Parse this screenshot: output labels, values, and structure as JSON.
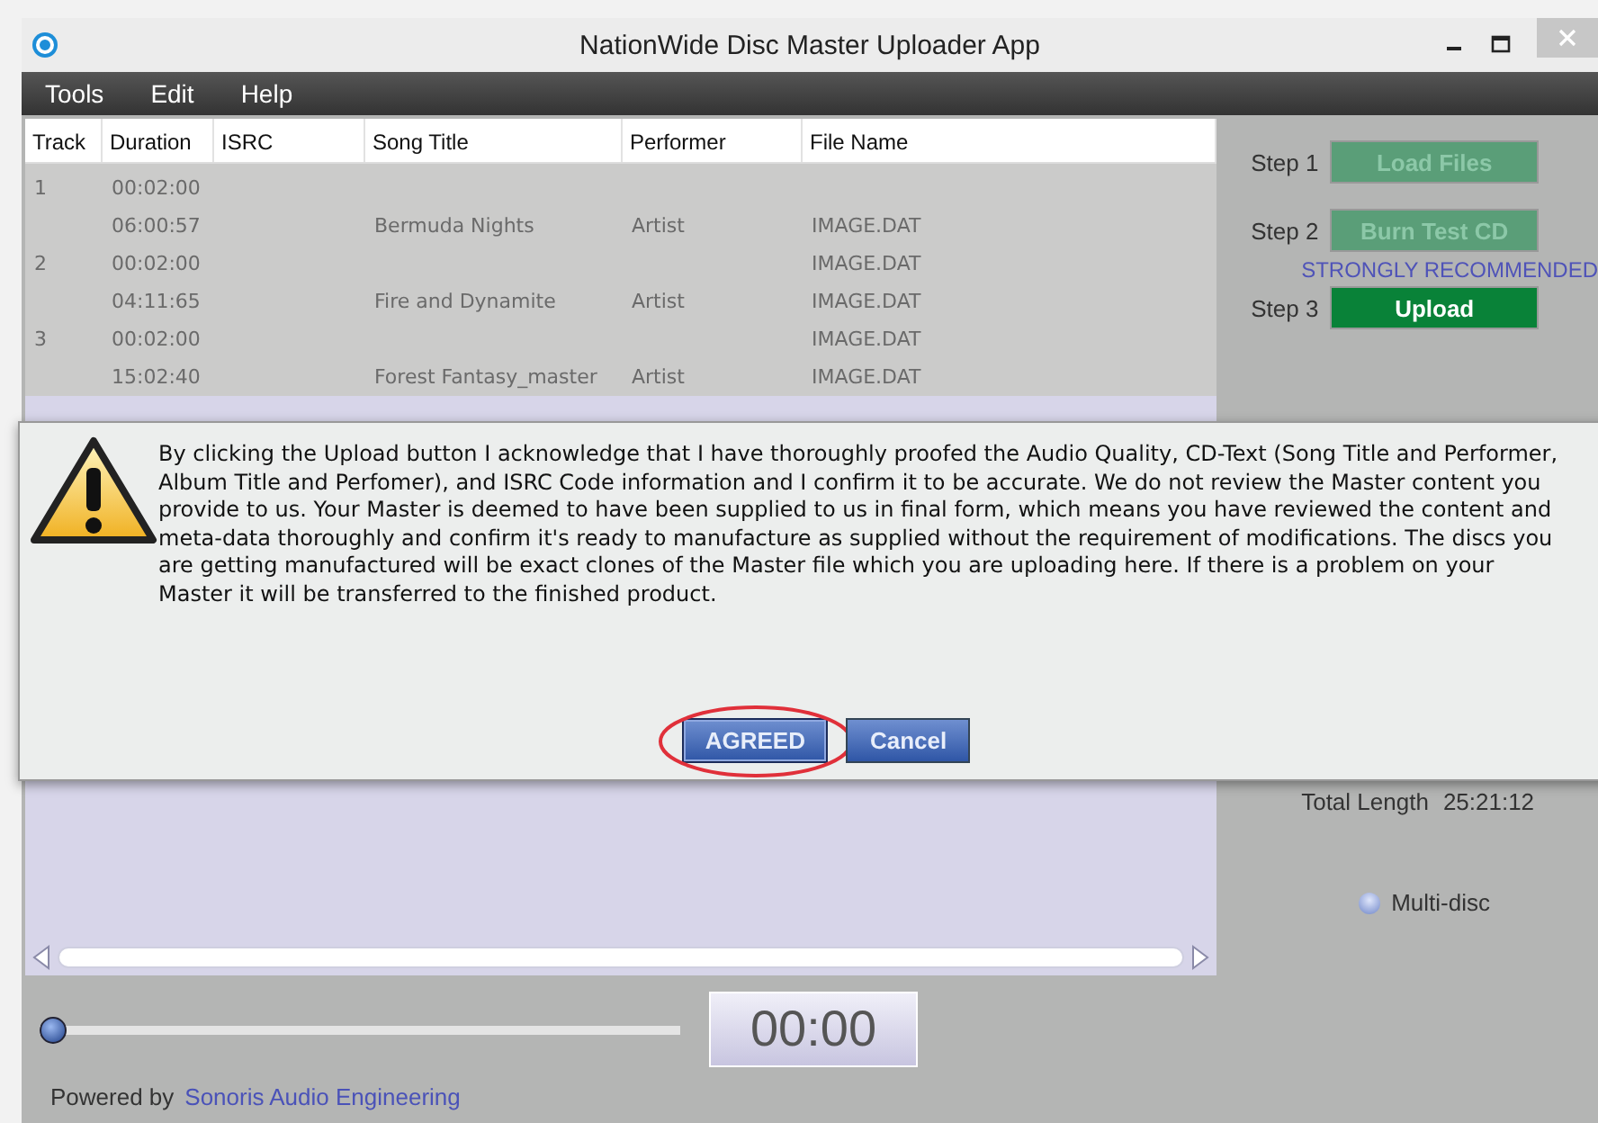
{
  "window": {
    "title": "NationWide Disc Master Uploader App"
  },
  "menu": [
    "Tools",
    "Edit",
    "Help"
  ],
  "table": {
    "columns": [
      "Track",
      "Duration",
      "ISRC",
      "Song Title",
      "Performer",
      "File Name"
    ],
    "rows": [
      {
        "track": "1",
        "duration": "00:02:00"
      },
      {
        "duration": "06:00:57",
        "title": "Bermuda Nights",
        "performer": "Artist",
        "file": "IMAGE.DAT"
      },
      {
        "track": "2",
        "duration": "00:02:00",
        "file": "IMAGE.DAT"
      },
      {
        "duration": "04:11:65",
        "title": "Fire and Dynamite",
        "performer": "Artist",
        "file": "IMAGE.DAT"
      },
      {
        "track": "3",
        "duration": "00:02:00",
        "file": "IMAGE.DAT"
      },
      {
        "duration": "15:02:40",
        "title": "Forest Fantasy_master",
        "performer": "Artist",
        "file": "IMAGE.DAT"
      }
    ]
  },
  "steps": [
    {
      "label": "Step 1",
      "button": "Load Files",
      "disabled": true
    },
    {
      "label": "Step 2",
      "button": "Burn Test CD",
      "disabled": true,
      "note": "STRONGLY RECOMMENDED"
    },
    {
      "label": "Step 3",
      "button": "Upload",
      "disabled": false
    }
  ],
  "total_length": {
    "label": "Total Length",
    "value": "25:21:12"
  },
  "multi_disc": {
    "label": "Multi-disc",
    "checked": false
  },
  "player": {
    "level": 0,
    "time": "00:00"
  },
  "footer": {
    "label": "Powered by",
    "link": "Sonoris Audio Engineering"
  },
  "dialog": {
    "message": "By clicking the Upload button I acknowledge that I have thoroughly proofed the Audio Quality, CD-Text (Song Title and Performer, Album Title and Perfomer), and ISRC Code information and I confirm it to be accurate. We do not review the Master content you provide to us. Your Master is deemed to have been supplied to us in final form, which means you have reviewed the content and meta-data thoroughly and confirm it's ready to manufacture as supplied without the requirement of modifications. The discs you are getting manufactured will be exact clones of the Master file which you are uploading here. If there is a problem on your Master it will be transferred to the finished product.",
    "buttons": [
      {
        "label": "AGREED",
        "highlighted": true
      },
      {
        "label": "Cancel",
        "highlighted": false
      }
    ]
  }
}
